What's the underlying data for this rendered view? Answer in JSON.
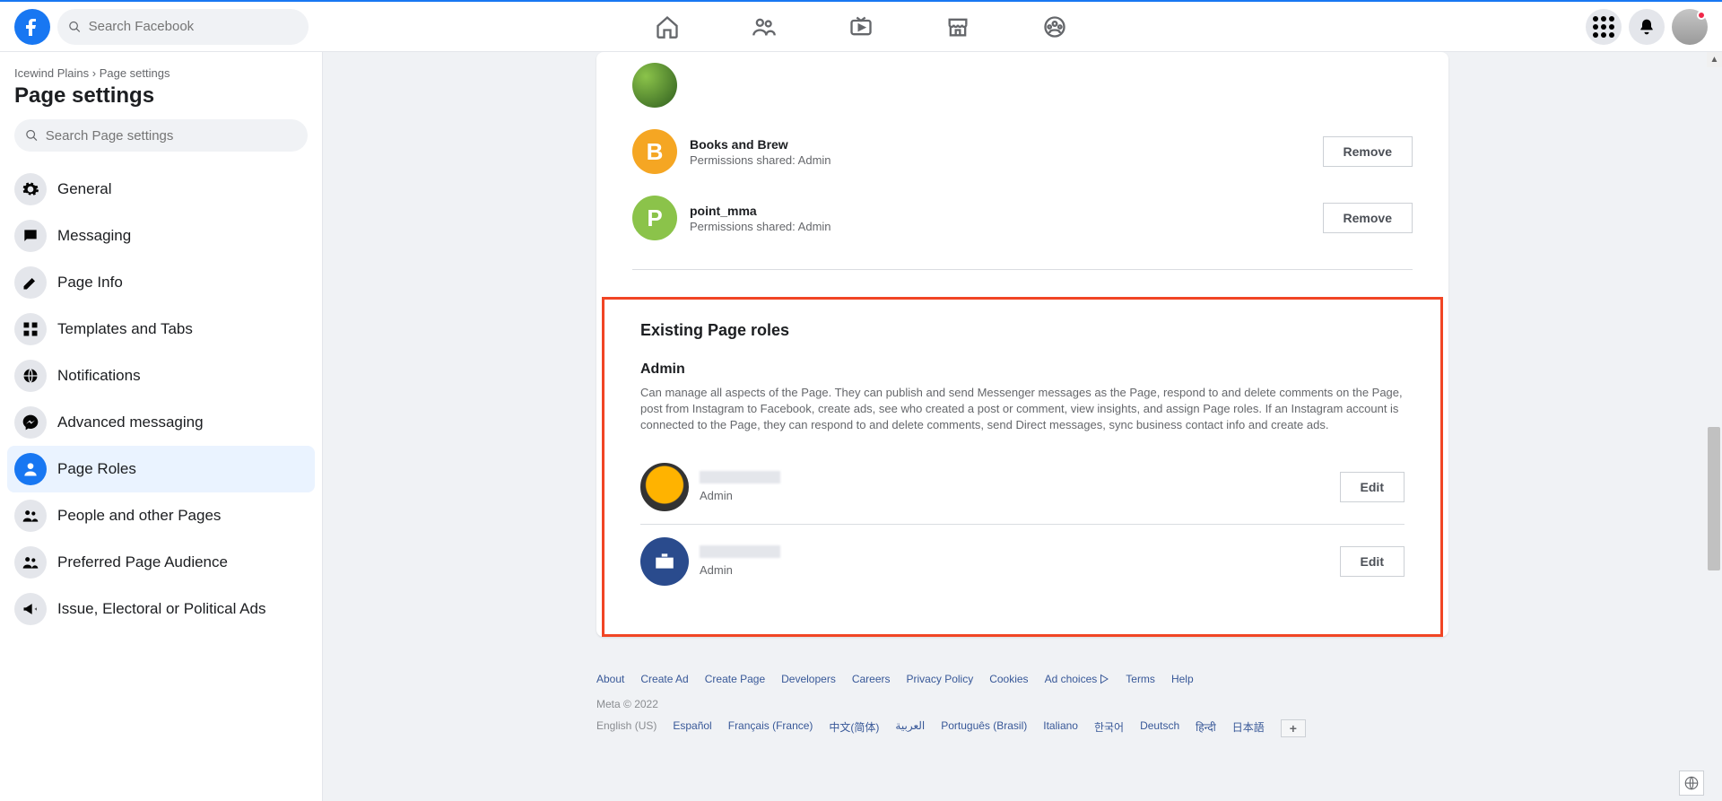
{
  "header": {
    "search_placeholder": "Search Facebook"
  },
  "breadcrumb": {
    "page_name": "Icewind Plains",
    "separator": "›",
    "current": "Page settings"
  },
  "page_title": "Page settings",
  "settings_search_placeholder": "Search Page settings",
  "sidebar": {
    "items": [
      {
        "label": "General"
      },
      {
        "label": "Messaging"
      },
      {
        "label": "Page Info"
      },
      {
        "label": "Templates and Tabs"
      },
      {
        "label": "Notifications"
      },
      {
        "label": "Advanced messaging"
      },
      {
        "label": "Page Roles"
      },
      {
        "label": "People and other Pages"
      },
      {
        "label": "Preferred Page Audience"
      },
      {
        "label": "Issue, Electoral or Political Ads"
      }
    ]
  },
  "partners": [
    {
      "name": "Books and Brew",
      "perm": "Permissions shared: Admin",
      "action": "Remove",
      "letter": "B",
      "color": "b"
    },
    {
      "name": "point_mma",
      "perm": "Permissions shared: Admin",
      "action": "Remove",
      "letter": "P",
      "color": "p"
    }
  ],
  "roles": {
    "section_title": "Existing Page roles",
    "role_name": "Admin",
    "role_desc": "Can manage all aspects of the Page. They can publish and send Messenger messages as the Page, respond to and delete comments on the Page, post from Instagram to Facebook, create ads, see who created a post or comment, view insights, and assign Page roles. If an Instagram account is connected to the Page, they can respond to and delete comments, send Direct messages, sync business contact info and create ads.",
    "entries": [
      {
        "role": "Admin",
        "action": "Edit"
      },
      {
        "role": "Admin",
        "action": "Edit"
      }
    ]
  },
  "footer": {
    "links": [
      "About",
      "Create Ad",
      "Create Page",
      "Developers",
      "Careers",
      "Privacy Policy",
      "Cookies",
      "Ad choices",
      "Terms",
      "Help"
    ],
    "meta": "Meta © 2022",
    "lang_current": "English (US)",
    "langs": [
      "Español",
      "Français (France)",
      "中文(简体)",
      "العربية",
      "Português (Brasil)",
      "Italiano",
      "한국어",
      "Deutsch",
      "हिन्दी",
      "日本語"
    ]
  }
}
